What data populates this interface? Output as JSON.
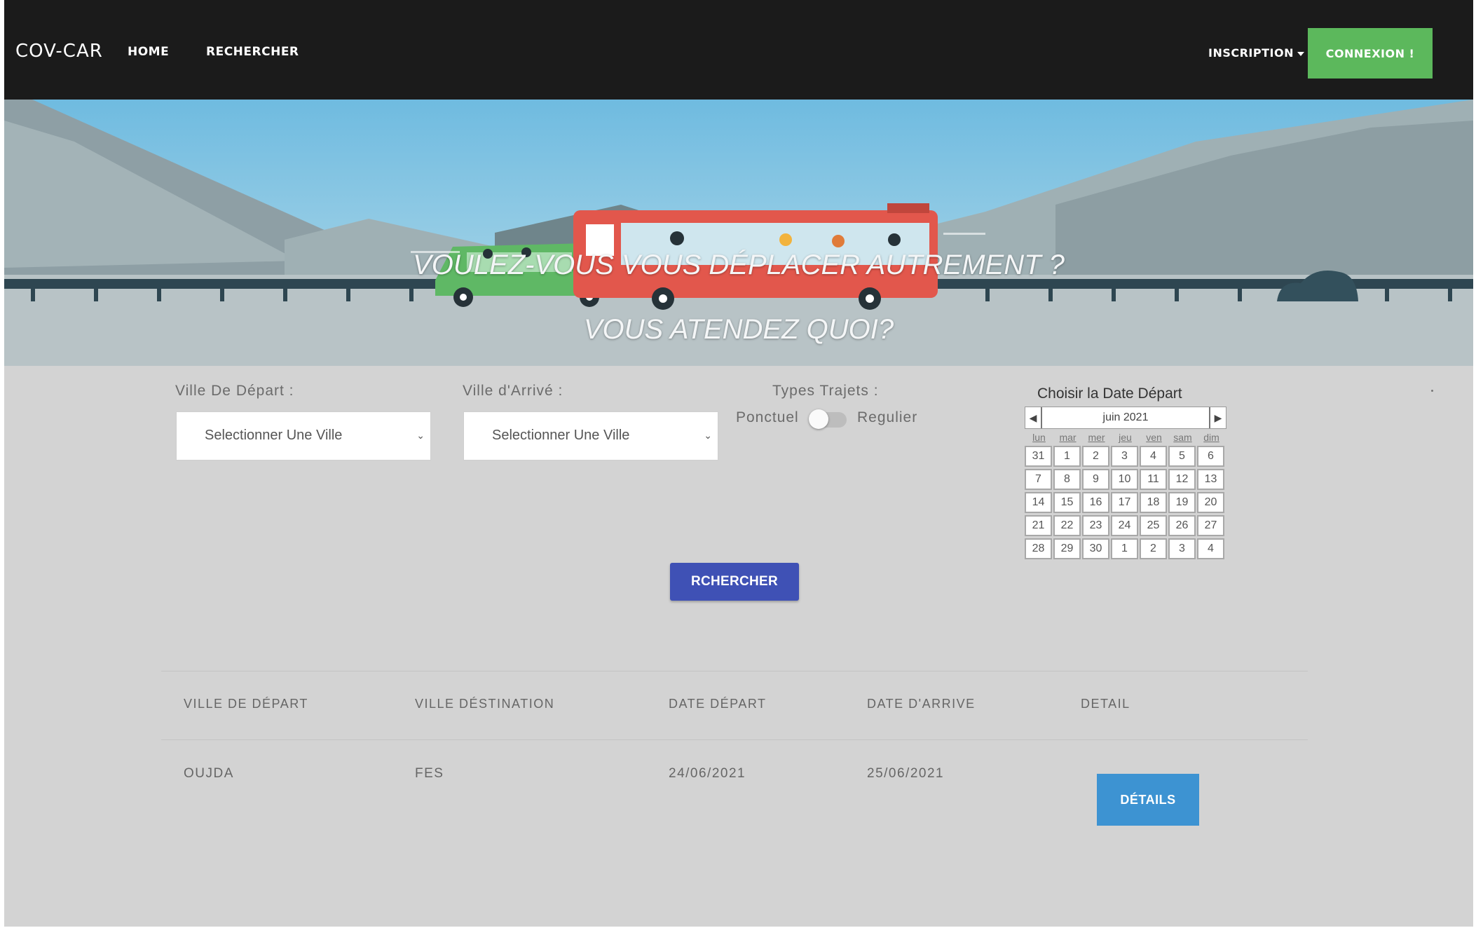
{
  "navbar": {
    "brand": "COV-CAR",
    "home": "HOME",
    "search": "RECHERCHER",
    "inscription": "INSCRIPTION",
    "connexion": "CONNEXION !"
  },
  "hero": {
    "title": "VOULEZ-VOUS VOUS DÉPLACER AUTREMENT ?",
    "subtitle": "VOUS ATENDEZ QUOI?"
  },
  "form": {
    "depart_label": "Ville De Départ :",
    "depart_select": "Selectionner Une Ville",
    "arrive_label": "Ville d'Arrivé :",
    "arrive_select": "Selectionner Une Ville",
    "types_label": "Types Trajets :",
    "ponctuel": "Ponctuel",
    "regulier": "Regulier",
    "search_button": "RCHERCHER"
  },
  "calendar": {
    "title": "Choisir la Date Départ",
    "month": "juin 2021",
    "days": [
      "lun",
      "mar",
      "mer",
      "jeu",
      "ven",
      "sam",
      "dim"
    ],
    "cells": [
      "31",
      "1",
      "2",
      "3",
      "4",
      "5",
      "6",
      "7",
      "8",
      "9",
      "10",
      "11",
      "12",
      "13",
      "14",
      "15",
      "16",
      "17",
      "18",
      "19",
      "20",
      "21",
      "22",
      "23",
      "24",
      "25",
      "26",
      "27",
      "28",
      "29",
      "30",
      "1",
      "2",
      "3",
      "4"
    ]
  },
  "table": {
    "headers": [
      "VILLE DE DÉPART",
      "VILLE DÉSTINATION",
      "DATE DÉPART",
      "DATE D'ARRIVE",
      "DETAIL"
    ],
    "rows": [
      {
        "depart": "OUJDA",
        "destination": "FES",
        "date_depart": "24/06/2021",
        "date_arrive": "25/06/2021",
        "detail_button": "DÉTAILS"
      }
    ]
  },
  "colors": {
    "navbar": "#1b1b1b",
    "connexion": "#5cb85c",
    "search_button": "#3f51b5",
    "detail_button": "#3d93d2",
    "page_bg": "#d3d3d3"
  }
}
